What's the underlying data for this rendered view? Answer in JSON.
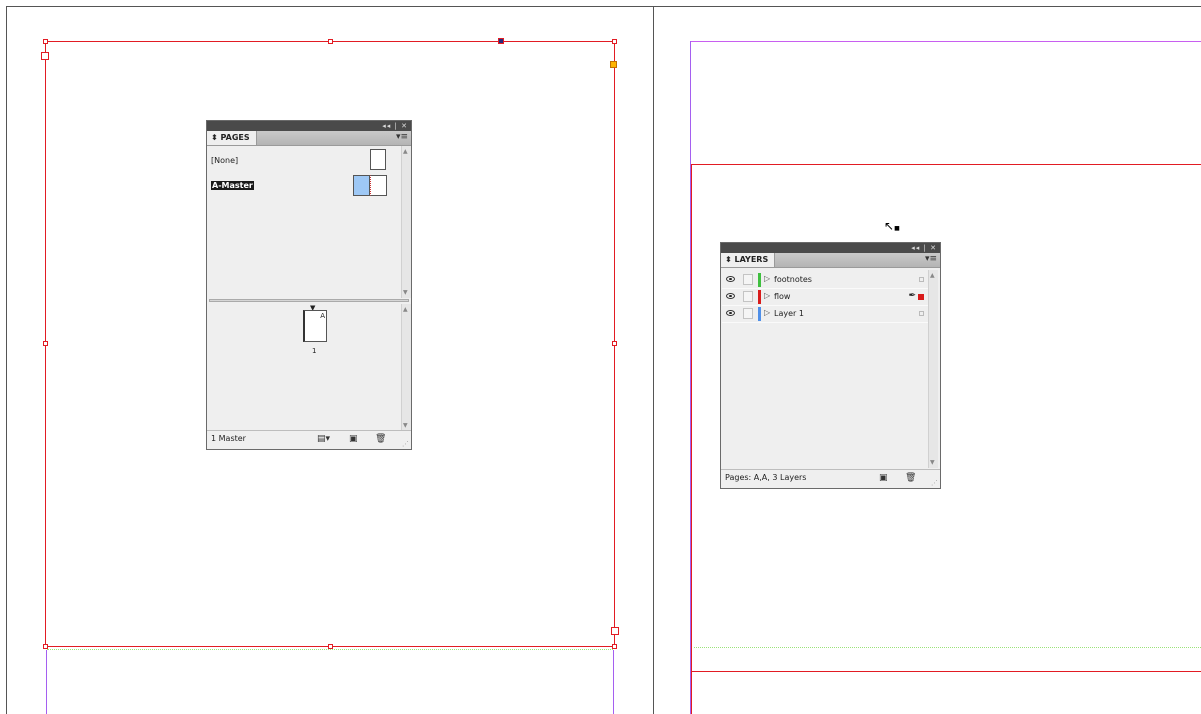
{
  "pages_panel": {
    "tab_label": "PAGES",
    "controls": "◂◂ | ✕",
    "masters": [
      {
        "label": "[None]"
      },
      {
        "label": "A-Master"
      }
    ],
    "page_thumb_letter": "A",
    "page_number": "1",
    "footer_text": "1 Master"
  },
  "layers_panel": {
    "tab_label": "LAYERS",
    "controls": "◂◂ | ✕",
    "layers": [
      {
        "name": "footnotes",
        "color": "#3fbf3f"
      },
      {
        "name": "flow",
        "color": "#d81b1b"
      },
      {
        "name": "Layer 1",
        "color": "#4f8fe8"
      }
    ],
    "footer_text": "Pages: A,A, 3 Layers"
  },
  "colors": {
    "margin_red": "#e21b23",
    "bleed_purple": "#a55ff0",
    "selected_master": "#1a1a1a"
  }
}
